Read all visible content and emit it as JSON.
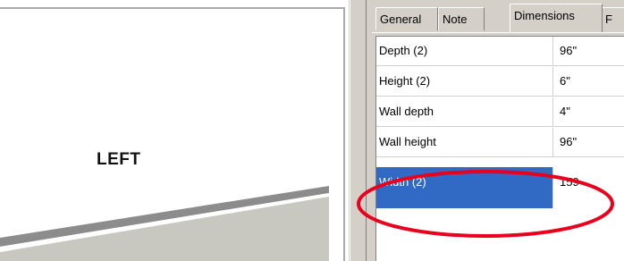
{
  "drawing_view": {
    "label": "LEFT"
  },
  "tabs": [
    {
      "label": "General",
      "active": false
    },
    {
      "label": "Note",
      "active": false
    },
    {
      "label": "Dimensions",
      "active": true
    },
    {
      "label": "F",
      "active": false
    }
  ],
  "properties": [
    {
      "name": "Depth (2)",
      "value": "96\"",
      "selected": false
    },
    {
      "name": "Height (2)",
      "value": "6\"",
      "selected": false
    },
    {
      "name": "Wall depth",
      "value": "4\"",
      "selected": false
    },
    {
      "name": "Wall height",
      "value": "96\"",
      "selected": false
    },
    {
      "name": "Width (2)",
      "value": "159",
      "selected": true
    }
  ],
  "colors": {
    "selection": "#316ac5",
    "annotation": "#e8001c",
    "panel": "#d4d0c8"
  }
}
